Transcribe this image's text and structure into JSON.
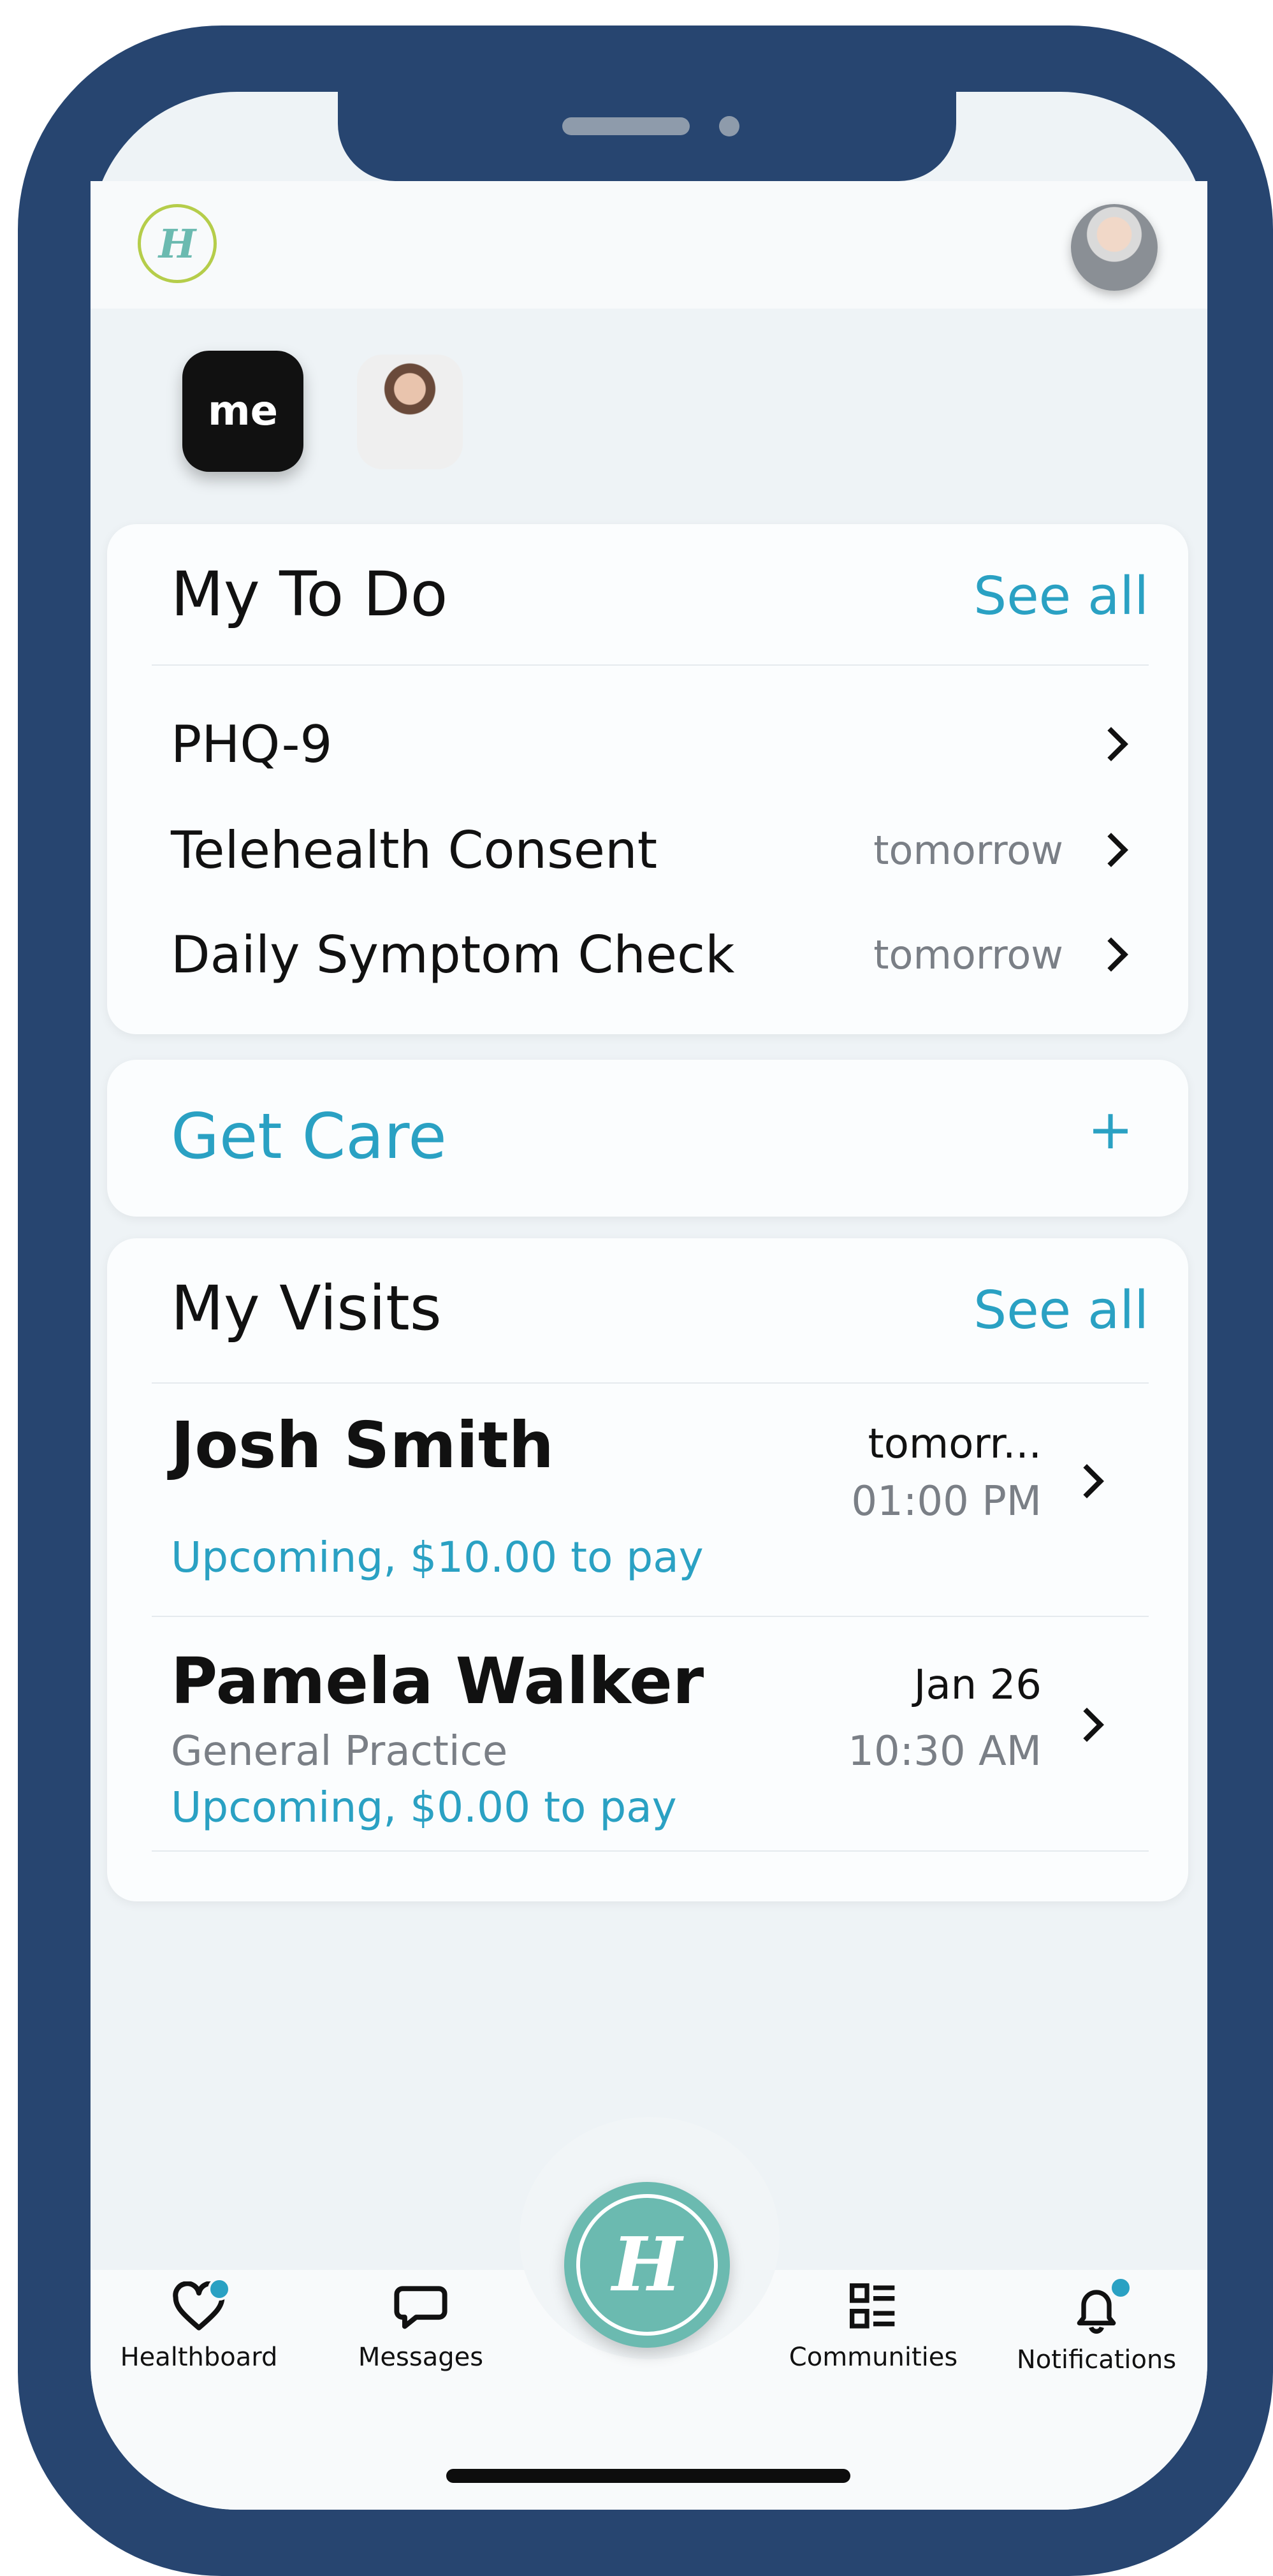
{
  "app": {
    "brand_initial": "H",
    "accent_color": "#2aa1c3",
    "brand_teal": "#6bbab0",
    "frame_color": "#274570"
  },
  "profiles": {
    "me_label": "me"
  },
  "todo": {
    "title": "My To Do",
    "see_all": "See all",
    "items": [
      {
        "label": "PHQ-9",
        "due": ""
      },
      {
        "label": "Telehealth Consent",
        "due": "tomorrow"
      },
      {
        "label": "Daily Symptom Check",
        "due": "tomorrow"
      }
    ]
  },
  "get_care": {
    "title": "Get Care",
    "plus": "+"
  },
  "visits": {
    "title": "My Visits",
    "see_all": "See all",
    "items": [
      {
        "name": "Josh Smith",
        "specialty": "",
        "status": "Upcoming, $10.00 to pay",
        "date": "tomorr...",
        "time": "01:00 PM"
      },
      {
        "name": "Pamela Walker",
        "specialty": "General Practice",
        "status": "Upcoming, $0.00 to pay",
        "date": "Jan 26",
        "time": "10:30 AM"
      }
    ]
  },
  "tabbar": {
    "items": [
      {
        "label": "Healthboard",
        "icon": "heart-icon",
        "badge": true
      },
      {
        "label": "Messages",
        "icon": "chat-bubble-icon",
        "badge": false
      },
      {
        "label": "Communities",
        "icon": "list-grid-icon",
        "badge": false
      },
      {
        "label": "Notifications",
        "icon": "bell-icon",
        "badge": true
      }
    ]
  }
}
